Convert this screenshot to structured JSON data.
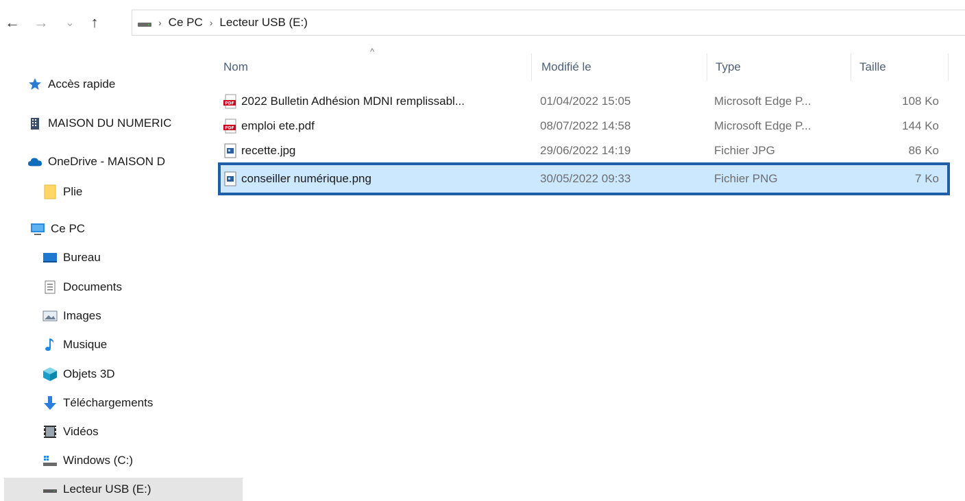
{
  "nav": {
    "back_icon": "←",
    "forward_icon": "→",
    "recent_icon": "⌄",
    "up_icon": "↑"
  },
  "address": {
    "crumbs": [
      "Ce PC",
      "Lecteur USB (E:)"
    ],
    "separator": "›"
  },
  "sidebar": {
    "items": [
      {
        "label": "Accès rapide",
        "icon": "star-icon"
      },
      {
        "label": "MAISON DU NUMERIC",
        "icon": "building-icon"
      },
      {
        "label": "OneDrive - MAISON D",
        "icon": "cloud-icon"
      },
      {
        "label": "Plie",
        "icon": "folder-icon"
      },
      {
        "label": "Ce PC",
        "icon": "monitor-icon"
      },
      {
        "label": "Bureau",
        "icon": "desktop-icon"
      },
      {
        "label": "Documents",
        "icon": "document-icon"
      },
      {
        "label": "Images",
        "icon": "images-icon"
      },
      {
        "label": "Musique",
        "icon": "music-icon"
      },
      {
        "label": "Objets 3D",
        "icon": "cube-icon"
      },
      {
        "label": "Téléchargements",
        "icon": "download-icon"
      },
      {
        "label": "Vidéos",
        "icon": "video-icon"
      },
      {
        "label": "Windows (C:)",
        "icon": "windows-drive-icon"
      },
      {
        "label": "Lecteur USB (E:)",
        "icon": "usb-drive-icon",
        "selected": true
      }
    ]
  },
  "columns": {
    "name": "Nom",
    "modified": "Modifié le",
    "type": "Type",
    "size": "Taille",
    "sort_indicator": "^"
  },
  "files": [
    {
      "name": "2022 Bulletin Adhésion MDNI remplissabl...",
      "modified": "01/04/2022 15:05",
      "type": "Microsoft Edge P...",
      "size": "108 Ko",
      "icon": "pdf-icon"
    },
    {
      "name": "emploi ete.pdf",
      "modified": "08/07/2022 14:58",
      "type": "Microsoft Edge P...",
      "size": "144 Ko",
      "icon": "pdf-icon"
    },
    {
      "name": "recette.jpg",
      "modified": "29/06/2022 14:19",
      "type": "Fichier JPG",
      "size": "86 Ko",
      "icon": "image-file-icon"
    },
    {
      "name": "conseiller numérique.png",
      "modified": "30/05/2022 09:33",
      "type": "Fichier PNG",
      "size": "7 Ko",
      "icon": "image-file-icon",
      "selected": true
    }
  ],
  "colors": {
    "selection_fill": "#cce8ff",
    "selection_border": "#1f5fa8",
    "header_text": "#4c607a",
    "pdf_red": "#d0021b"
  }
}
